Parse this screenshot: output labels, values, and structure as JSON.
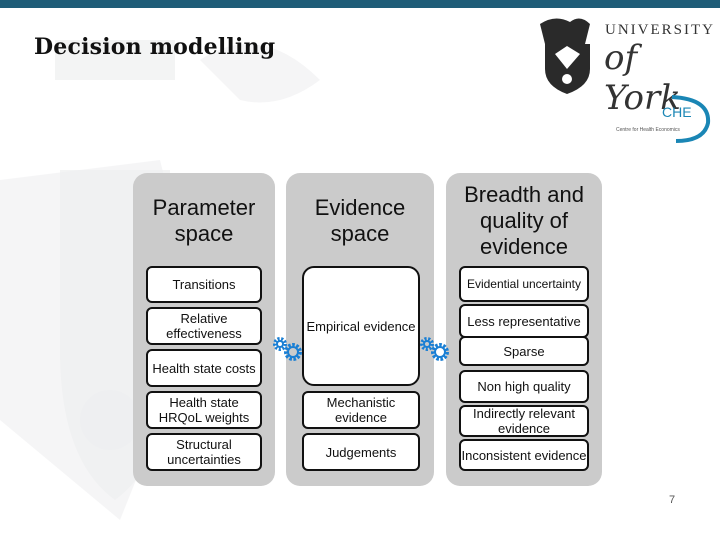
{
  "header": {
    "title": "Decision modelling"
  },
  "logos": {
    "york_line1": "UNIVERSITY",
    "york_line2": "of York",
    "che_abbr": "CHE",
    "che_full": "Centre for Health Economics"
  },
  "colors": {
    "topbar": "#1f5d78",
    "panel": "#cbcbcb",
    "gear": "#1a7fd4"
  },
  "panels": [
    {
      "title": "Parameter space",
      "items": [
        "Transitions",
        "Relative effectiveness",
        "Health state costs",
        "Health state HRQoL weights",
        "Structural uncertainties"
      ]
    },
    {
      "title": "Evidence space",
      "items": [
        "Empirical evidence",
        "Mechanistic evidence",
        "Judgements"
      ]
    },
    {
      "title": "Breadth and quality of evidence",
      "items": [
        "Evidential uncertainty",
        "Less representative",
        "Sparse",
        "Non high quality",
        "Indirectly relevant evidence",
        "Inconsistent evidence"
      ]
    }
  ],
  "connectors": [
    "gears-icon",
    "gears-icon"
  ],
  "footer": {
    "page_number": "7"
  }
}
